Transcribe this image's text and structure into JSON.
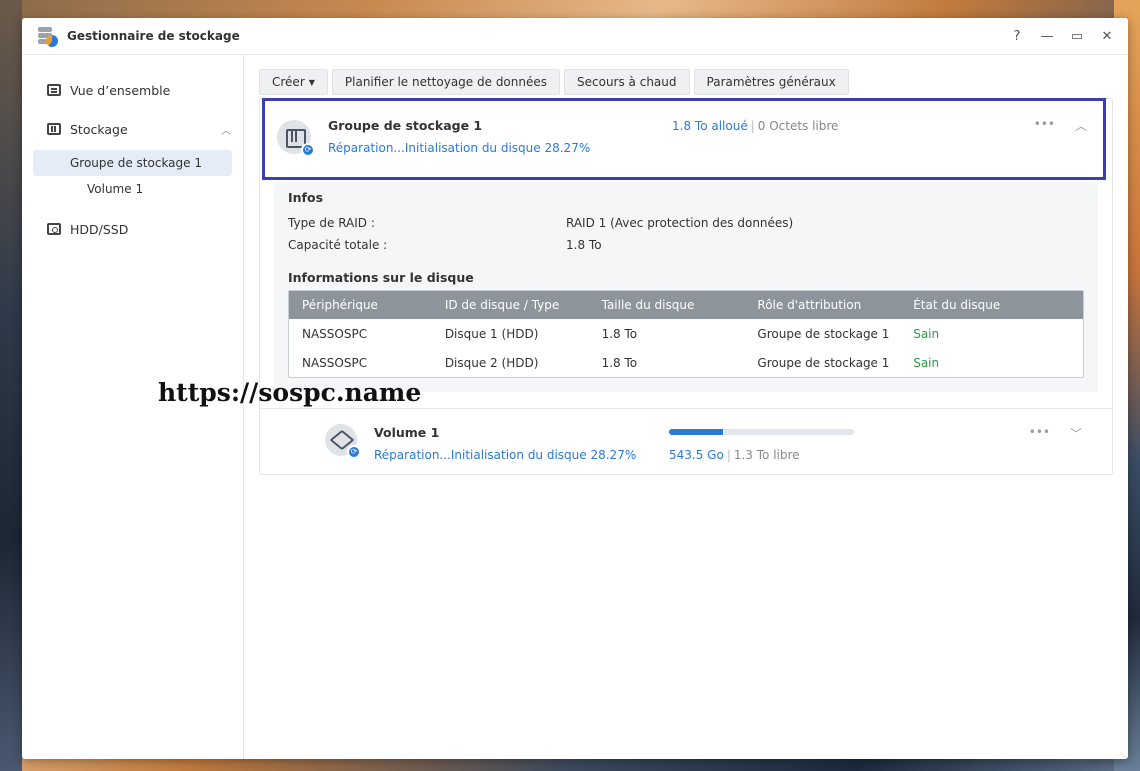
{
  "window": {
    "title": "Gestionnaire de stockage",
    "controls": {
      "help": "?",
      "minimize": "—",
      "maximize": "▭",
      "close": "✕"
    }
  },
  "sidebar": {
    "overview": "Vue d’ensemble",
    "storage": "Stockage",
    "storage_pool": "Groupe de stockage 1",
    "volume": "Volume 1",
    "hdd": "HDD/SSD"
  },
  "toolbar": {
    "create": "Créer",
    "schedule_cleanup": "Planifier le nettoyage de données",
    "hot_spare": "Secours à chaud",
    "general_settings": "Paramètres généraux"
  },
  "pool": {
    "name": "Groupe de stockage 1",
    "status": "Réparation...Initialisation du disque 28.27%",
    "allocated": "1.8 To alloué",
    "free": "0 Octets libre",
    "info_title": "Infos",
    "raid_label": "Type de RAID :",
    "raid_value": "RAID 1 (Avec protection des données)",
    "capacity_label": "Capacité totale :",
    "capacity_value": "1.8 To",
    "disk_info_title": "Informations sur le disque"
  },
  "disk_table": {
    "headers": [
      "Périphérique",
      "ID de disque / Type",
      "Taille du disque",
      "Rôle d'attribution",
      "État du disque"
    ],
    "rows": [
      [
        "NASSOSPC",
        "Disque 1 (HDD)",
        "1.8 To",
        "Groupe de stockage 1",
        "Sain"
      ],
      [
        "NASSOSPC",
        "Disque 2 (HDD)",
        "1.8 To",
        "Groupe de stockage 1",
        "Sain"
      ]
    ]
  },
  "volume": {
    "name": "Volume 1",
    "status": "Réparation...Initialisation du disque 28.27%",
    "used": "543.5 Go",
    "free": "1.3 To libre",
    "usage_fraction": 0.29
  },
  "watermark": "https://sospc.name",
  "colors": {
    "accent": "#2a7ad8",
    "highlight_border": "#3b3fb3",
    "healthy": "#2c9a46"
  }
}
